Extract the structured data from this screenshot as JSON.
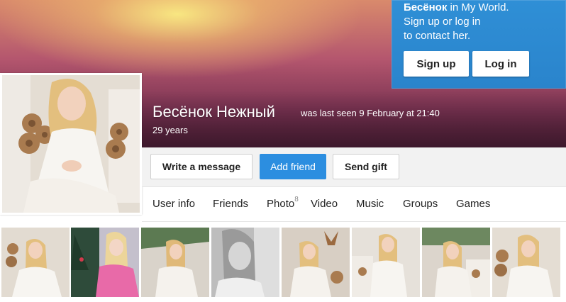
{
  "promo": {
    "name": "Бесёнок",
    "line1_rest": " in My World.",
    "line2": "Sign up or log in",
    "line3": "to contact her.",
    "signup_label": "Sign up",
    "login_label": "Log in"
  },
  "profile": {
    "name": "Бесёнок Нежный",
    "last_seen": "was last seen 9 February at 21:40",
    "age": "29 years"
  },
  "actions": {
    "write_message": "Write a message",
    "add_friend": "Add friend",
    "send_gift": "Send gift"
  },
  "tabs": [
    {
      "label": "User info"
    },
    {
      "label": "Friends"
    },
    {
      "label": "Photo",
      "count": "8"
    },
    {
      "label": "Video"
    },
    {
      "label": "Music"
    },
    {
      "label": "Groups"
    },
    {
      "label": "Games"
    }
  ],
  "colors": {
    "accent": "#2c8ee0",
    "promo_bg": "#2f8fd6"
  }
}
